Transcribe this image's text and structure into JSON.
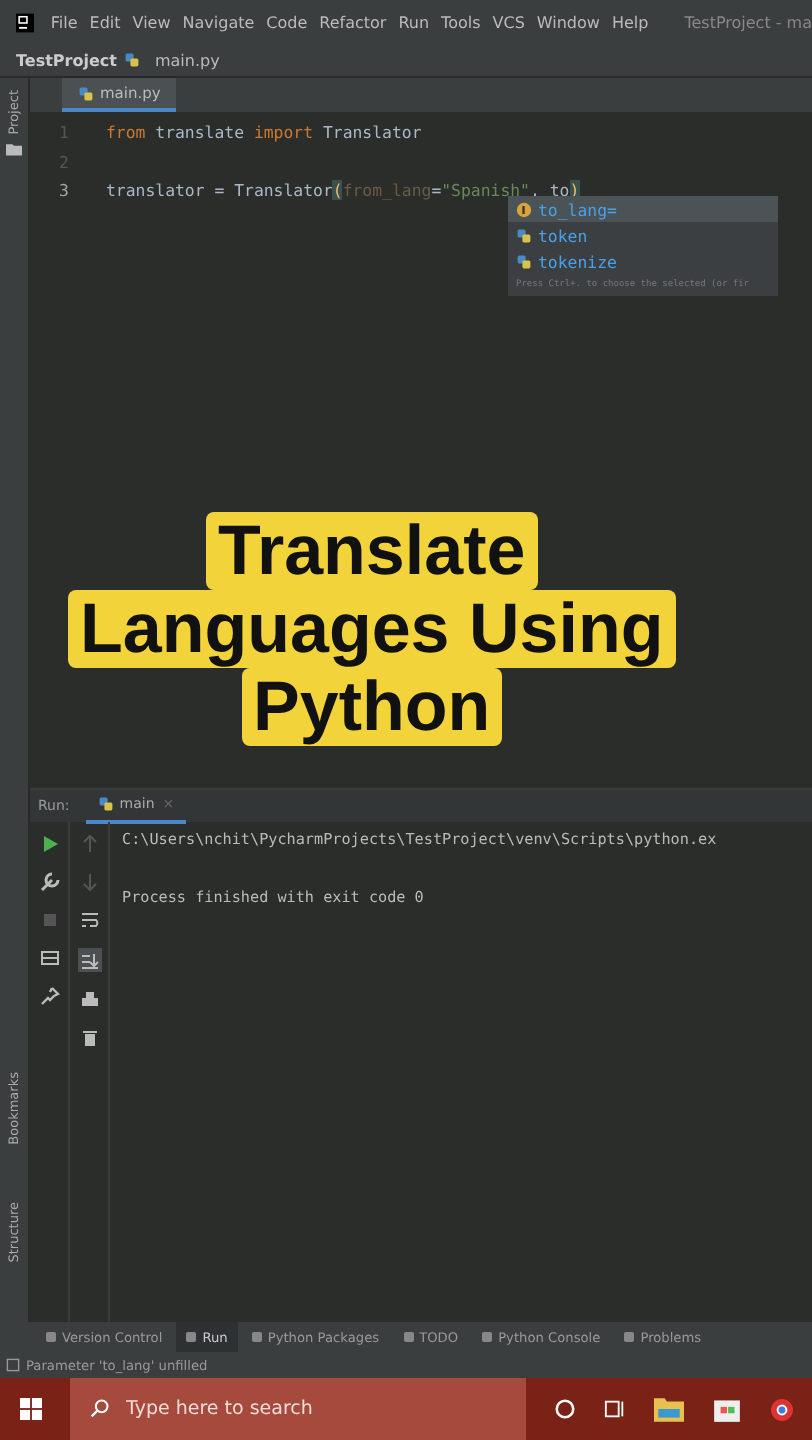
{
  "menu_bar": {
    "items": [
      "File",
      "Edit",
      "View",
      "Navigate",
      "Code",
      "Refactor",
      "Run",
      "Tools",
      "VCS",
      "Window",
      "Help"
    ],
    "title": "TestProject - ma"
  },
  "breadcrumb": {
    "project": "TestProject",
    "file": "main.py"
  },
  "side_labels_top": [
    "Project"
  ],
  "side_labels_bottom": [
    "Bookmarks",
    "Structure"
  ],
  "editor": {
    "tab": {
      "label": "main.py",
      "selected": true
    },
    "lines": [
      {
        "number": "1",
        "tokens": [
          {
            "kind": "keyword",
            "text": "from"
          },
          {
            "kind": "plain",
            "text": " translate "
          },
          {
            "kind": "keyword",
            "text": "import"
          },
          {
            "kind": "plain",
            "text": " Translator"
          }
        ]
      },
      {
        "number": "2"
      },
      {
        "number": "3",
        "tokens": [
          {
            "kind": "plain",
            "text": "translator = Translator"
          },
          {
            "kind": "paren",
            "text": "("
          },
          {
            "kind": "param",
            "text": "from_lang"
          },
          {
            "kind": "plain",
            "text": "="
          },
          {
            "kind": "string",
            "text": "\"Spanish\""
          },
          {
            "kind": "plain",
            "text": ", to"
          },
          {
            "kind": "paren",
            "text": ")"
          }
        ]
      }
    ]
  },
  "completion": {
    "items": [
      {
        "kind": "parameter",
        "text": "to_lang=",
        "selected": true
      },
      {
        "kind": "function",
        "text": "token",
        "selected": false
      },
      {
        "kind": "function",
        "text": "tokenize",
        "selected": false
      }
    ],
    "hint": "Press Ctrl+. to choose the selected (or fir"
  },
  "caption": [
    "Translate",
    "Languages Using",
    "Python"
  ],
  "run": {
    "label": "Run:",
    "tab": "main",
    "tab_close": "×",
    "output": [
      "C:\\Users\\nchit\\PycharmProjects\\TestProject\\venv\\Scripts\\python.ex",
      "Process finished with exit code 0"
    ]
  },
  "tool_tabs": [
    {
      "label": "Version Control",
      "selected": false
    },
    {
      "label": "Run",
      "selected": true
    },
    {
      "label": "Python Packages",
      "selected": false
    },
    {
      "label": "TODO",
      "selected": false
    },
    {
      "label": "Python Console",
      "selected": false
    },
    {
      "label": "Problems",
      "selected": false
    }
  ],
  "status": "Parameter 'to_lang' unfilled",
  "taskbar": {
    "search": {
      "placeholder": "Type here to search"
    }
  }
}
